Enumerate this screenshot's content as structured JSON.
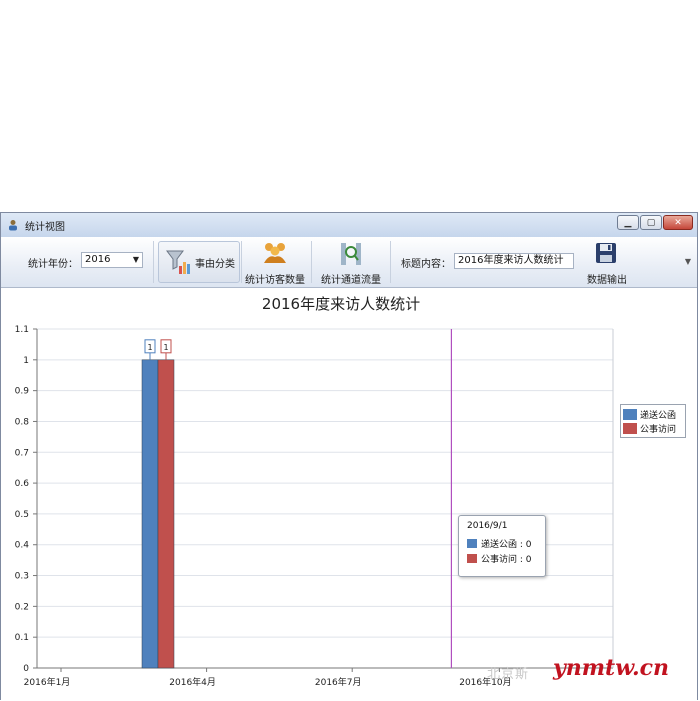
{
  "window": {
    "title": "统计视图",
    "controls": [
      "minimize",
      "maximize",
      "close"
    ]
  },
  "toolbar": {
    "year_label": "统计年份：",
    "year_value": "2016",
    "btn_category": "事由分类",
    "btn_visitors": "统计访客数量",
    "btn_channel": "统计通道流量",
    "title_label": "标题内容：",
    "title_value": "2016年度来访人数统计",
    "btn_export": "数据输出"
  },
  "colors": {
    "series1": "#4f81bd",
    "series2": "#c0504d",
    "crosshair": "#b04fbf",
    "grid": "#dfe3ea"
  },
  "chart_data": {
    "type": "bar",
    "title": "2016年度来访人数统计",
    "x_axis_ticks": [
      "2016年1月",
      "2016年4月",
      "2016年7月",
      "2016年10月"
    ],
    "y_axis_ticks": [
      "0",
      "0.1",
      "0.2",
      "0.3",
      "0.4",
      "0.5",
      "0.6",
      "0.7",
      "0.8",
      "0.9",
      "1",
      "1.1"
    ],
    "ylim": [
      0,
      1.1
    ],
    "x_range": [
      "2015-12-17",
      "2016-12-11"
    ],
    "series": [
      {
        "name": "递送公函",
        "values": [
          {
            "date": "2016-03-01",
            "value": 1
          }
        ]
      },
      {
        "name": "公事访问",
        "values": [
          {
            "date": "2016-03-01",
            "value": 1
          }
        ]
      }
    ],
    "data_labels": [
      "1",
      "1"
    ],
    "legend": "right",
    "grid": true,
    "crosshair": {
      "date": "2016-09-01",
      "label": "2016/9/1",
      "entries": [
        {
          "name": "递送公函",
          "text": "递送公函 : 0"
        },
        {
          "name": "公事访问",
          "text": "公事访问 : 0"
        }
      ]
    }
  },
  "watermark": {
    "cn_text": "北京斯",
    "site_text": "ynmtw.cn"
  }
}
